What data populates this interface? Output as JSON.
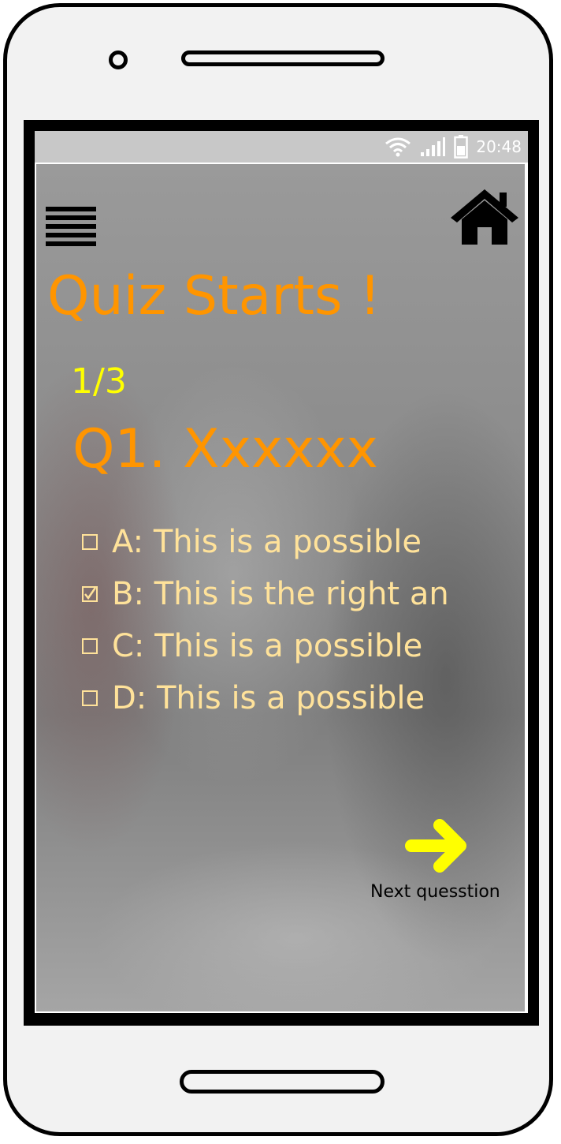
{
  "status_bar": {
    "time": "20:48",
    "wifi_icon": "wifi-icon",
    "signal_icon": "signal-icon",
    "battery_icon": "battery-icon"
  },
  "header": {
    "menu_icon": "hamburger-menu-icon",
    "home_icon": "home-icon"
  },
  "quiz": {
    "title": "Quiz Starts !",
    "progress": "1/3",
    "question": "Q1. Xxxxxx",
    "options": [
      {
        "label": "A:   This is a possible",
        "checked": false
      },
      {
        "label": "B: This is the right an",
        "checked": true
      },
      {
        "label": "C: This is a possible",
        "checked": false
      },
      {
        "label": "D: This is a possible",
        "checked": false
      }
    ]
  },
  "navigation": {
    "next_icon": "right-arrow-icon",
    "next_label": "Next quesstion"
  },
  "colors": {
    "title": "#ff9500",
    "progress": "#ffff00",
    "option_text": "#ffe29a",
    "next_arrow": "#ffff00"
  }
}
